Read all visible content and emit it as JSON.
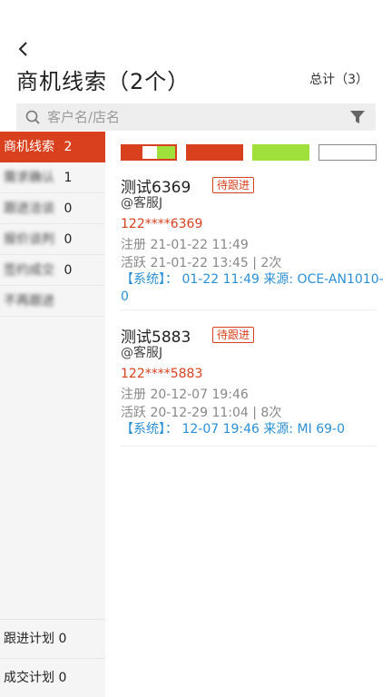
{
  "header": {
    "back_icon": "chevron-left-icon",
    "title": "商机线索（2个）",
    "total": "总计（3）"
  },
  "search": {
    "placeholder": "客户名/店名",
    "search_icon": "search-icon",
    "filter_icon": "filter-icon"
  },
  "sidebar": {
    "items": [
      {
        "label": "商机线索",
        "count": "2",
        "active": true
      },
      {
        "label": "需求确认",
        "count": "1"
      },
      {
        "label": "跟进洽谈",
        "count": "0"
      },
      {
        "label": "报价谈判",
        "count": "0"
      },
      {
        "label": "签约成交",
        "count": "0"
      },
      {
        "label": "不再跟进",
        "count": ""
      }
    ],
    "bottom": [
      {
        "label": "跟进计划",
        "count": "0"
      },
      {
        "label": "成交计划",
        "count": "0"
      }
    ]
  },
  "legend_colors": {
    "red": "#d9411e",
    "green": "#9fe03a",
    "white": "#ffffff"
  },
  "leads": [
    {
      "name": "测试6369",
      "status": "待跟进",
      "owner": "@客服J",
      "phone": "122****6369",
      "registered": "注册 21-01-22 11:49",
      "active": "活跃 21-01-22 13:45 | 2次",
      "system": "【系统】： 01-22 11:49 来源: OCE-AN1010-0"
    },
    {
      "name": "测试5883",
      "status": "待跟进",
      "owner": "@客服J",
      "phone": "122****5883",
      "registered": "注册 20-12-07 19:46",
      "active": "活跃 20-12-29 11:04 | 8次",
      "system": "【系统】： 12-07 19:46 来源: MI 69-0"
    }
  ]
}
